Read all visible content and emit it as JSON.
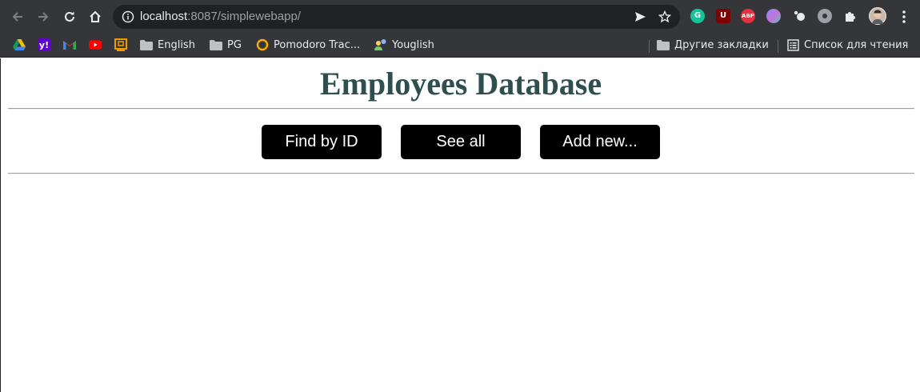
{
  "browser": {
    "url_host": "localhost",
    "url_path": ":8087/simplewebapp/",
    "extensions": [
      {
        "name": "grammarly-icon",
        "label": "G",
        "color": "#15c39a"
      },
      {
        "name": "ublock-icon",
        "label": "U",
        "color": "#800000"
      },
      {
        "name": "adblock-plus-icon",
        "label": "ABP",
        "color": "#e2313f"
      }
    ]
  },
  "bookmarks": {
    "items": [
      {
        "label": "English"
      },
      {
        "label": "PG"
      },
      {
        "label": "Pomodoro Trac..."
      },
      {
        "label": "Youglish"
      }
    ],
    "other_bookmarks": "Другие закладки",
    "reading_list": "Список для чтения"
  },
  "page": {
    "title": "Employees Database",
    "buttons": {
      "find_by_id": "Find by ID",
      "see_all": "See all",
      "add_new": "Add new..."
    }
  },
  "colors": {
    "title": "#2f4f4f",
    "button_bg": "#000000",
    "button_text": "#ffffff",
    "chrome_bg": "#35363a",
    "omnibox_bg": "#202124"
  }
}
